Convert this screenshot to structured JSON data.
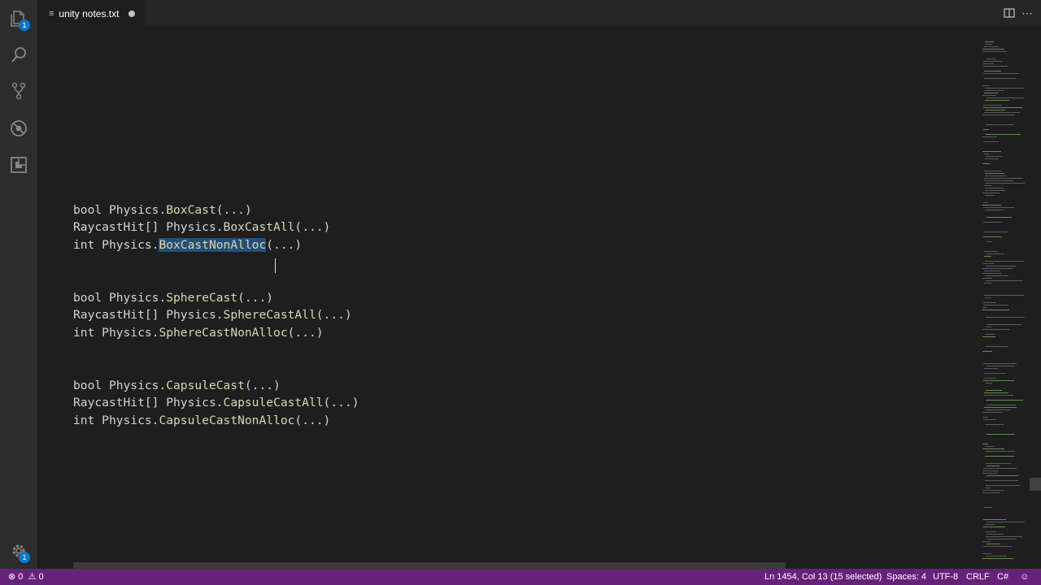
{
  "tab": {
    "title": "unity notes.txt"
  },
  "activity_bar": {
    "items": [
      {
        "icon": "explorer-icon",
        "badge": "1"
      },
      {
        "icon": "search-icon"
      },
      {
        "icon": "source-control-icon"
      },
      {
        "icon": "debug-icon"
      },
      {
        "icon": "extensions-icon"
      }
    ],
    "manage_badge": "1"
  },
  "code": {
    "lines": [
      {
        "type": "bool ",
        "cls": "Physics.",
        "fn": "BoxCast",
        "args": "(...)"
      },
      {
        "type": "RaycastHit[] ",
        "cls": "Physics.",
        "fn": "BoxCastAll",
        "args": "(...)"
      },
      {
        "type": "int ",
        "cls": "Physics.",
        "fn": "BoxCastNonAlloc",
        "args": "(...)"
      },
      {
        "type": "bool ",
        "cls": "Physics.",
        "fn": "SphereCast",
        "args": "(...)"
      },
      {
        "type": "RaycastHit[] ",
        "cls": "Physics.",
        "fn": "SphereCastAll",
        "args": "(...)"
      },
      {
        "type": "int ",
        "cls": "Physics.",
        "fn": "SphereCastNonAlloc",
        "args": "(...)"
      },
      {
        "type": "bool ",
        "cls": "Physics.",
        "fn": "CapsuleCast",
        "args": "(...)"
      },
      {
        "type": "RaycastHit[] ",
        "cls": "Physics.",
        "fn": "CapsuleCastAll",
        "args": "(...)"
      },
      {
        "type": "int ",
        "cls": "Physics.",
        "fn": "CapsuleCastNonAlloc",
        "args": "(...)"
      }
    ]
  },
  "status": {
    "errors": "0",
    "warnings": "0",
    "position": "Ln 1454, Col 13 (15 selected)",
    "spaces": "Spaces: 4",
    "encoding": "UTF-8",
    "eol": "CRLF",
    "language": "C#"
  },
  "colors": {
    "status_bar": "#68217a",
    "selection": "#264f78",
    "badge": "#007acc"
  }
}
